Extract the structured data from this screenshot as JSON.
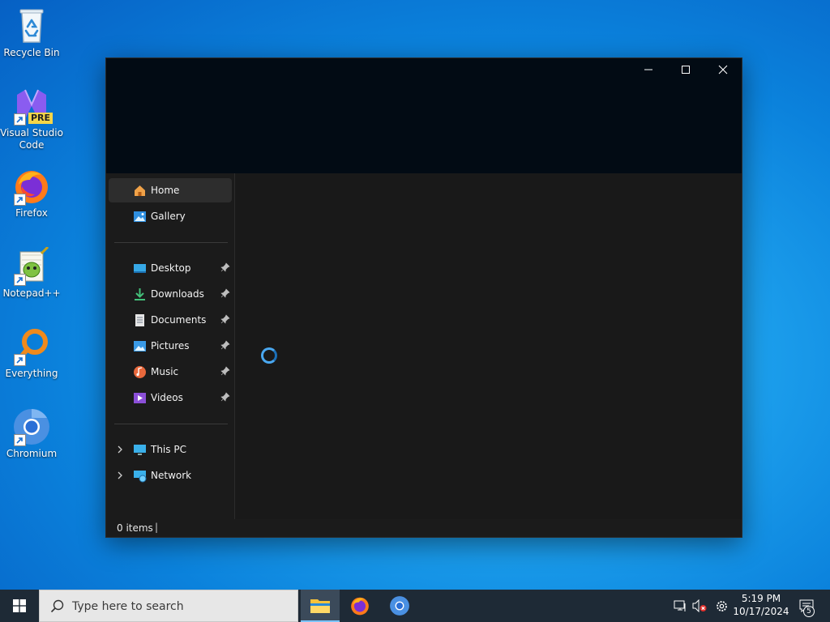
{
  "desktop": {
    "icons": [
      {
        "label": "Recycle Bin"
      },
      {
        "label": "Visual Studio Code",
        "line1": "Visual Studio",
        "line2": "Code",
        "badge": "PRE"
      },
      {
        "label": "Firefox"
      },
      {
        "label": "Notepad++"
      },
      {
        "label": "Everything"
      },
      {
        "label": "Chromium"
      }
    ]
  },
  "explorer": {
    "window_controls": {
      "minimize": "minimize-icon",
      "maximize": "maximize-icon",
      "close": "close-icon"
    },
    "nav_primary": [
      {
        "label": "Home",
        "icon": "home-icon",
        "selected": true
      },
      {
        "label": "Gallery",
        "icon": "gallery-icon"
      }
    ],
    "nav_quick_access": [
      {
        "label": "Desktop",
        "icon": "desktop-folder-icon",
        "pinned": true
      },
      {
        "label": "Downloads",
        "icon": "downloads-icon",
        "pinned": true
      },
      {
        "label": "Documents",
        "icon": "documents-icon",
        "pinned": true
      },
      {
        "label": "Pictures",
        "icon": "pictures-icon",
        "pinned": true
      },
      {
        "label": "Music",
        "icon": "music-icon",
        "pinned": true
      },
      {
        "label": "Videos",
        "icon": "videos-icon",
        "pinned": true
      }
    ],
    "nav_locations": [
      {
        "label": "This PC",
        "icon": "this-pc-icon"
      },
      {
        "label": "Network",
        "icon": "network-icon"
      }
    ],
    "status": {
      "items": "0 items",
      "divider": "|"
    },
    "loading": true
  },
  "taskbar": {
    "search_placeholder": "Type here to search",
    "pinned": [
      {
        "name": "File Explorer",
        "icon": "file-explorer-icon",
        "active": true
      },
      {
        "name": "Firefox",
        "icon": "firefox-icon"
      },
      {
        "name": "Chromium",
        "icon": "chromium-icon"
      }
    ],
    "clock": {
      "time": "5:19 PM",
      "date": "10/17/2024"
    },
    "notifications_count": "5"
  },
  "colors": {
    "accent": "#0078d4",
    "window_bg": "#191919",
    "titlebar_bg": "#020b14",
    "taskbar_bg": "#1e2a36"
  }
}
